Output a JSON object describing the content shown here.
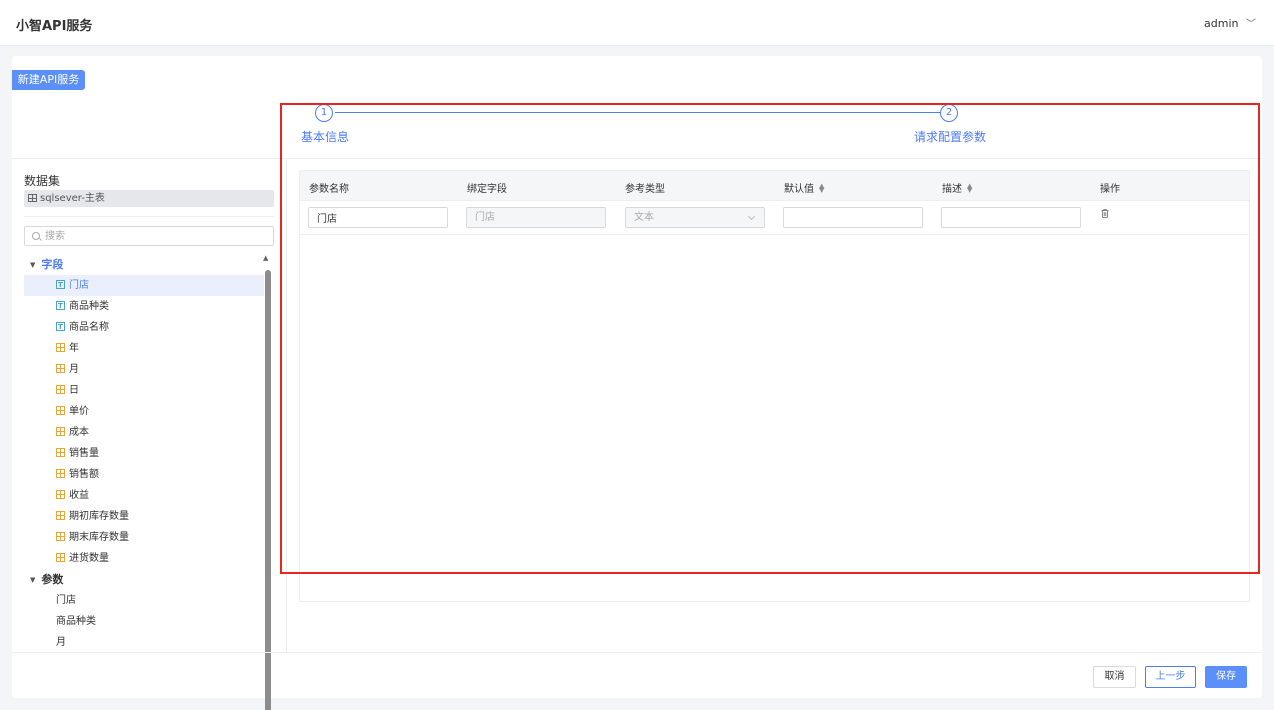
{
  "header": {
    "app_title": "小智API服务",
    "user": "admin"
  },
  "toolbar": {
    "new_button": "新建API服务"
  },
  "steps": [
    {
      "number": "1",
      "label": "基本信息"
    },
    {
      "number": "2",
      "label": "请求配置参数"
    }
  ],
  "dataset": {
    "title": "数据集",
    "chip": "sqlsever-主表",
    "search_placeholder": "搜索"
  },
  "tree": {
    "fields_group": "字段",
    "fields": [
      {
        "label": "门店",
        "type": "text",
        "selected": true
      },
      {
        "label": "商品种类",
        "type": "text"
      },
      {
        "label": "商品名称",
        "type": "text"
      },
      {
        "label": "年",
        "type": "number"
      },
      {
        "label": "月",
        "type": "number"
      },
      {
        "label": "日",
        "type": "number"
      },
      {
        "label": "单价",
        "type": "number"
      },
      {
        "label": "成本",
        "type": "number"
      },
      {
        "label": "销售量",
        "type": "number"
      },
      {
        "label": "销售额",
        "type": "number"
      },
      {
        "label": "收益",
        "type": "number"
      },
      {
        "label": "期初库存数量",
        "type": "number"
      },
      {
        "label": "期末库存数量",
        "type": "number"
      },
      {
        "label": "进货数量",
        "type": "number"
      }
    ],
    "params_group": "参数",
    "params": [
      "门店",
      "商品种类",
      "月"
    ]
  },
  "table": {
    "headers": {
      "param_name": "参数名称",
      "bind_field": "绑定字段",
      "ref_type": "参考类型",
      "default_value": "默认值",
      "description": "描述",
      "actions": "操作"
    },
    "rows": [
      {
        "param_name": "门店",
        "bind_field": "门店",
        "ref_type": "文本",
        "default_value": "",
        "description": ""
      }
    ]
  },
  "footer": {
    "cancel": "取消",
    "prev": "上一步",
    "save": "保存"
  },
  "colors": {
    "accent": "#4e7cf1",
    "primary_button": "#5b8ff9",
    "highlight": "#e8261f"
  }
}
